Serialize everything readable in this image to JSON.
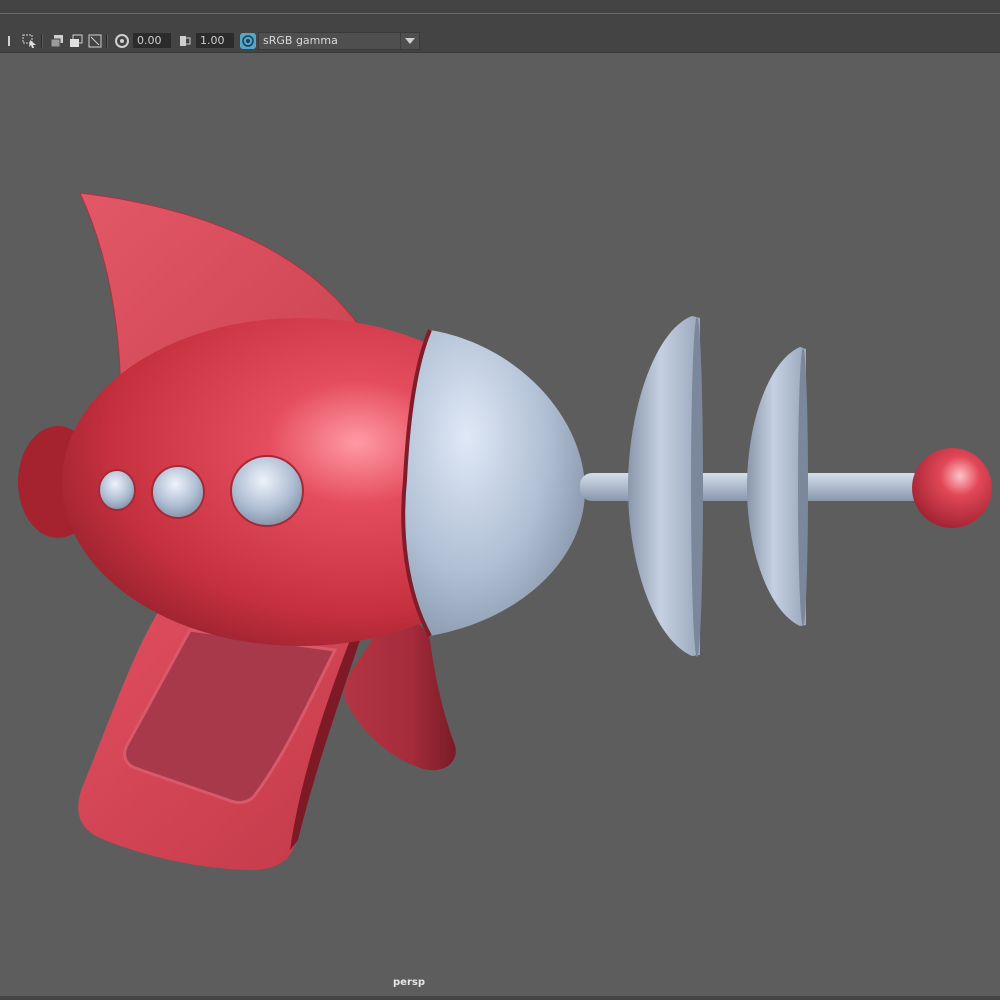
{
  "toolbar": {
    "exposure_value": "0.00",
    "gamma_value": "1.00",
    "color_space": "sRGB gamma",
    "icons": [
      "snapshot-icon",
      "select-camera-icon",
      "isolate-icon",
      "xray-icon",
      "resolution-gate-icon",
      "exposure-icon",
      "gamma-icon",
      "color-management-icon",
      "dropdown-arrow-icon"
    ]
  },
  "viewport": {
    "camera_label": "persp",
    "background_color": "#5d5d5d"
  },
  "colors": {
    "model_red": "#c83a4a",
    "model_grey_blue": "#b4c2d6",
    "toolbar_bg": "#444444",
    "accent": "#56a6c8"
  }
}
